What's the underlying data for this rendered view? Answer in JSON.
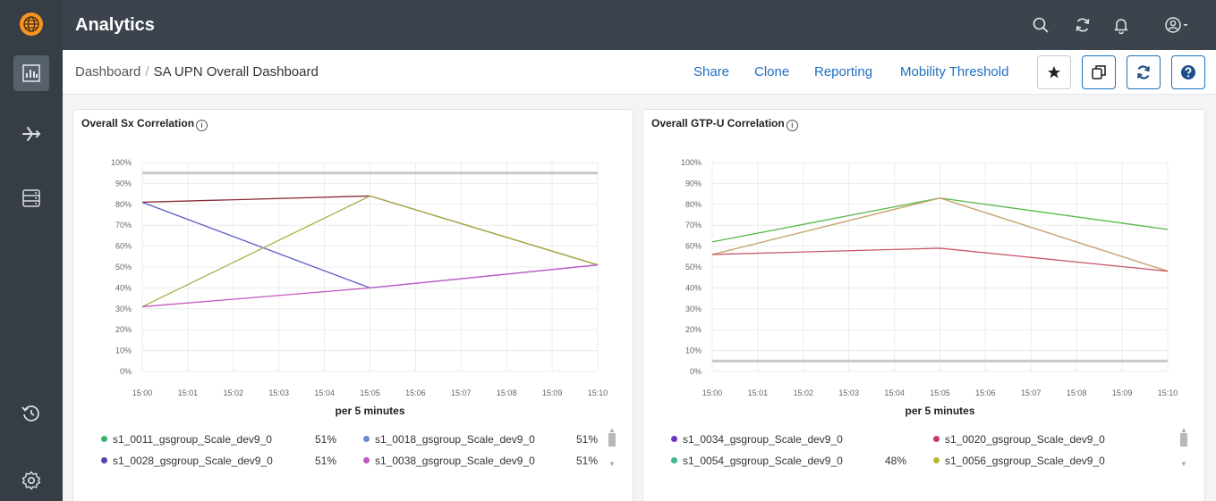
{
  "app": {
    "title": "Analytics"
  },
  "breadcrumb": {
    "root": "Dashboard",
    "separator": "/",
    "current": "SA UPN Overall Dashboard"
  },
  "actions": {
    "share": "Share",
    "clone": "Clone",
    "reporting": "Reporting",
    "mobility": "Mobility Threshold"
  },
  "colors": {
    "sidebar": "#363d45",
    "topbar": "#3b434c",
    "accent": "#1f70c1",
    "logo": "#f7931e"
  },
  "panels": [
    {
      "title": "Overall Sx Correlation",
      "legend": [
        {
          "label": "s1_0011_gsgroup_Scale_dev9_0",
          "value": "51%",
          "color": "#3cb371"
        },
        {
          "label": "s1_0018_gsgroup_Scale_dev9_0",
          "value": "51%",
          "color": "#6b8bd6"
        },
        {
          "label": "s1_0028_gsgroup_Scale_dev9_0",
          "value": "51%",
          "color": "#5b3fb0"
        },
        {
          "label": "s1_0038_gsgroup_Scale_dev9_0",
          "value": "51%",
          "color": "#c156c5"
        }
      ]
    },
    {
      "title": "Overall GTP-U Correlation",
      "legend": [
        {
          "label": "s1_0034_gsgroup_Scale_dev9_0",
          "value": "",
          "color": "#6c35c0"
        },
        {
          "label": "s1_0020_gsgroup_Scale_dev9_0",
          "value": "",
          "color": "#c8356f"
        },
        {
          "label": "s1_0054_gsgroup_Scale_dev9_0",
          "value": "48%",
          "color": "#3cb890"
        },
        {
          "label": "s1_0056_gsgroup_Scale_dev9_0",
          "value": "",
          "color": "#b5b82b"
        }
      ]
    }
  ],
  "chart_data": [
    {
      "type": "line",
      "title": "Overall Sx Correlation",
      "xlabel": "per 5 minutes",
      "x_ticks": [
        "15:00",
        "15:01",
        "15:02",
        "15:03",
        "15:04",
        "15:05",
        "15:06",
        "15:07",
        "15:08",
        "15:09",
        "15:10"
      ],
      "y_ticks": [
        "0%",
        "10%",
        "20%",
        "30%",
        "40%",
        "50%",
        "60%",
        "70%",
        "80%",
        "90%",
        "100%"
      ],
      "ylim": [
        0,
        100
      ],
      "x": [
        "15:00",
        "15:05",
        "15:10"
      ],
      "reference_line": 95,
      "series": [
        {
          "values": [
            81,
            84,
            51
          ],
          "color": "#8b2d3a"
        },
        {
          "values": [
            81,
            40,
            51
          ],
          "color": "#5b5bc0"
        },
        {
          "values": [
            31,
            84,
            51
          ],
          "color": "#a6b040"
        },
        {
          "values": [
            31,
            40,
            51
          ],
          "color": "#c156c5"
        }
      ]
    },
    {
      "type": "line",
      "title": "Overall GTP-U Correlation",
      "xlabel": "per 5 minutes",
      "x_ticks": [
        "15:00",
        "15:01",
        "15:02",
        "15:03",
        "15:04",
        "15:05",
        "15:06",
        "15:07",
        "15:08",
        "15:09",
        "15:10"
      ],
      "y_ticks": [
        "0%",
        "10%",
        "20%",
        "30%",
        "40%",
        "50%",
        "60%",
        "70%",
        "80%",
        "90%",
        "100%"
      ],
      "ylim": [
        0,
        100
      ],
      "x": [
        "15:00",
        "15:05",
        "15:10"
      ],
      "reference_line": 5,
      "series": [
        {
          "values": [
            62,
            83,
            68
          ],
          "color": "#55b847"
        },
        {
          "values": [
            56,
            83,
            48
          ],
          "color": "#3cc09a"
        },
        {
          "values": [
            56,
            83,
            48
          ],
          "color": "#d9a46c"
        },
        {
          "values": [
            56,
            59,
            48
          ],
          "color": "#c8556a"
        }
      ]
    }
  ]
}
